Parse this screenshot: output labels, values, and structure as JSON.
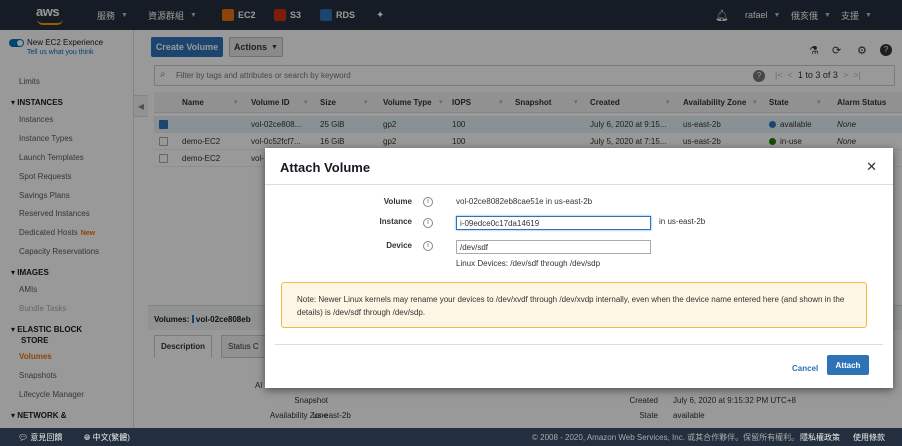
{
  "topnav": {
    "logo": "aws",
    "services": "服務",
    "resource_groups": "資源群組",
    "shortcuts": [
      {
        "label": "EC2",
        "color": "#ec7211",
        "icon": "ec2-icon"
      },
      {
        "label": "S3",
        "color": "#d13212",
        "icon": "s3-icon"
      },
      {
        "label": "RDS",
        "color": "#2e73b8",
        "icon": "rds-icon"
      }
    ],
    "pin_icon": "pin-icon",
    "bell_icon": "bell-icon",
    "user": "rafael",
    "region": "俄亥俄",
    "support": "支援"
  },
  "sidebar": {
    "new_experience": "New EC2 Experience",
    "tell_us": "Tell us what you think",
    "limits": "Limits",
    "sections": {
      "instances": "INSTANCES",
      "images": "IMAGES",
      "ebs_line1": "ELASTIC BLOCK",
      "ebs_line2": "STORE",
      "network": "NETWORK &"
    },
    "instances_items": [
      "Instances",
      "Instance Types",
      "Launch Templates",
      "Spot Requests",
      "Savings Plans",
      "Reserved Instances",
      "Dedicated Hosts",
      "Capacity Reservations"
    ],
    "new_badge": "New",
    "images_items": [
      "AMIs",
      "Bundle Tasks"
    ],
    "ebs_items": [
      "Volumes",
      "Snapshots",
      "Lifecycle Manager"
    ]
  },
  "toolbar": {
    "create_volume": "Create Volume",
    "actions": "Actions",
    "lab_icon": "flask-icon",
    "refresh_icon": "refresh-icon",
    "settings_icon": "gear-icon",
    "help_icon": "help-icon"
  },
  "search": {
    "placeholder": "Filter by tags and attributes or search by keyword",
    "pagination": "1 to 3 of 3"
  },
  "table": {
    "columns": [
      "Name",
      "Volume ID",
      "Size",
      "Volume Type",
      "IOPS",
      "Snapshot",
      "Created",
      "Availability Zone",
      "State",
      "Alarm Status"
    ],
    "rows": [
      {
        "name": "",
        "volume_id": "vol-02ce808...",
        "size": "25 GiB",
        "type": "gp2",
        "iops": "100",
        "snapshot": "",
        "created": "July 6, 2020 at 9:15...",
        "az": "us-east-2b",
        "state": "available",
        "state_color": "#2e73b8",
        "alarm": "None"
      },
      {
        "name": "demo-EC2",
        "volume_id": "vol-0c52fcf7...",
        "size": "16 GiB",
        "type": "gp2",
        "iops": "100",
        "snapshot": "",
        "created": "July 5, 2020 at 7:15...",
        "az": "us-east-2b",
        "state": "in-use",
        "state_color": "#1d8102",
        "alarm": "None"
      },
      {
        "name": "demo-EC2",
        "volume_id": "vol-",
        "size": "",
        "type": "",
        "iops": "",
        "snapshot": "",
        "created": "",
        "az": "",
        "state": "",
        "state_color": "#1d8102",
        "alarm": ""
      }
    ]
  },
  "details": {
    "volumes_label": "Volumes:",
    "volume_id": "vol-02ce808eb",
    "tabs": [
      "Description",
      "Status C"
    ],
    "snapshot_label": "Snapshot",
    "snapshot_value": "-",
    "az_label": "Availability Zone",
    "az_value": "us-east-2b",
    "created_label": "Created",
    "created_value": "July 6, 2020 at 9:15:32 PM UTC+8",
    "state_label": "State",
    "state_value": "available",
    "al_label": "Al"
  },
  "modal": {
    "title": "Attach Volume",
    "volume_label": "Volume",
    "volume_value": "vol-02ce8082eb8cae51e in us-east-2b",
    "instance_label": "Instance",
    "instance_value": "i-09edce0c17da14619",
    "instance_suffix": "in us-east-2b",
    "device_label": "Device",
    "device_value": "/dev/sdf",
    "device_hint": "Linux Devices: /dev/sdf through /dev/sdp",
    "note": "Note: Newer Linux kernels may rename your devices to /dev/xvdf through /dev/xvdp internally, even when the device name entered here (and shown in the details) is /dev/sdf through /dev/sdp.",
    "cancel": "Cancel",
    "attach": "Attach"
  },
  "footer": {
    "feedback": "意見回饋",
    "language": "中文(繁體)",
    "copyright": "© 2008 - 2020, Amazon Web Services, Inc. 或其合作夥伴。保留所有權利。",
    "privacy": "隱私權政策",
    "terms": "使用條款"
  }
}
